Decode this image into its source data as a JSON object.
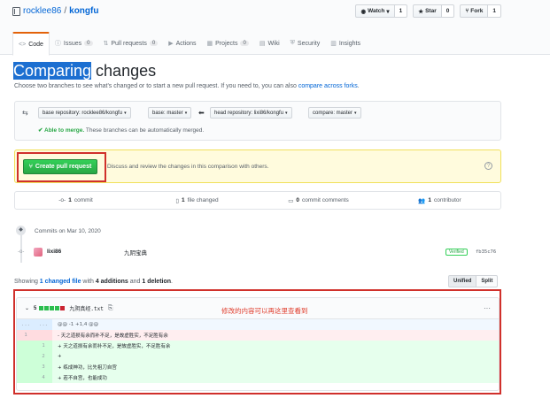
{
  "repo": {
    "owner": "rocklee86",
    "separator": "/",
    "name": "kongfu"
  },
  "actions": {
    "watch": {
      "label": "Watch",
      "count": "1"
    },
    "star": {
      "label": "Star",
      "count": "0"
    },
    "fork": {
      "label": "Fork",
      "count": "1"
    }
  },
  "tabs": [
    {
      "label": "Code",
      "icon": "<>"
    },
    {
      "label": "Issues",
      "badge": "0",
      "icon": "ⓘ"
    },
    {
      "label": "Pull requests",
      "badge": "0",
      "icon": "⇅"
    },
    {
      "label": "Actions",
      "icon": "▶"
    },
    {
      "label": "Projects",
      "badge": "0",
      "icon": "▦"
    },
    {
      "label": "Wiki",
      "icon": "▤"
    },
    {
      "label": "Security",
      "icon": "⛨"
    },
    {
      "label": "Insights",
      "icon": "▥"
    }
  ],
  "page": {
    "title_highlight": "Comparing",
    "title_rest": " changes",
    "subtitle": "Choose two branches to see what's changed or to start a new pull request. If you need to, you can also ",
    "subtitle_link": "compare across forks",
    "subtitle_end": "."
  },
  "range": {
    "base_repo": "base repository: rocklee86/kongfu",
    "base": "base: master",
    "head_repo": "head repository: lixi86/kongfu",
    "compare": "compare: master",
    "merge_ok": "✔ Able to merge.",
    "merge_text": " These branches can be automatically merged."
  },
  "pr": {
    "button": "Create pull request",
    "text": "Discuss and review the changes in this comparison with others.",
    "help": "?"
  },
  "stats": [
    {
      "icon": "-o-",
      "count": "1",
      "label": " commit"
    },
    {
      "icon": "▯",
      "count": "1",
      "label": " file changed"
    },
    {
      "icon": "▭",
      "count": "0",
      "label": " commit comments"
    },
    {
      "icon": "👥",
      "count": "1",
      "label": " contributor"
    }
  ],
  "commits": {
    "date_label": "Commits on Mar 10, 2020",
    "author": "lixi86",
    "message": "九阴宝典",
    "verified": "Verified",
    "sha": "fb35c76"
  },
  "summary": {
    "prefix": "Showing ",
    "link": "1 changed file",
    "mid1": " with ",
    "additions": "4 additions",
    "mid2": " and ",
    "deletions": "1 deletion",
    "end": "."
  },
  "view": {
    "unified": "Unified",
    "split": "Split"
  },
  "file": {
    "changes": "5",
    "name": "九阴真经.txt",
    "note": "修改的内容可以再这里查看到",
    "menu": "···",
    "hunk_left": "...",
    "hunk_right": "...",
    "hunk": "@@ -1 +1,4 @@",
    "lines": [
      {
        "old": "1",
        "new": "",
        "text": "- 天之道损有余而补不足，是故虚胜实，不足胜有余"
      },
      {
        "old": "",
        "new": "1",
        "text": "+ 天之道损有余而补不足，是故虚胜实，不足胜有余"
      },
      {
        "old": "",
        "new": "2",
        "text": "+"
      },
      {
        "old": "",
        "new": "3",
        "text": "+ 练成神功，比先祖刀自宫"
      },
      {
        "old": "",
        "new": "4",
        "text": "+ 若不自宫，也能成功"
      }
    ]
  },
  "colors": {
    "accent": "#0366d6",
    "create": "#2ea44f",
    "annotation": "#d0302b"
  }
}
